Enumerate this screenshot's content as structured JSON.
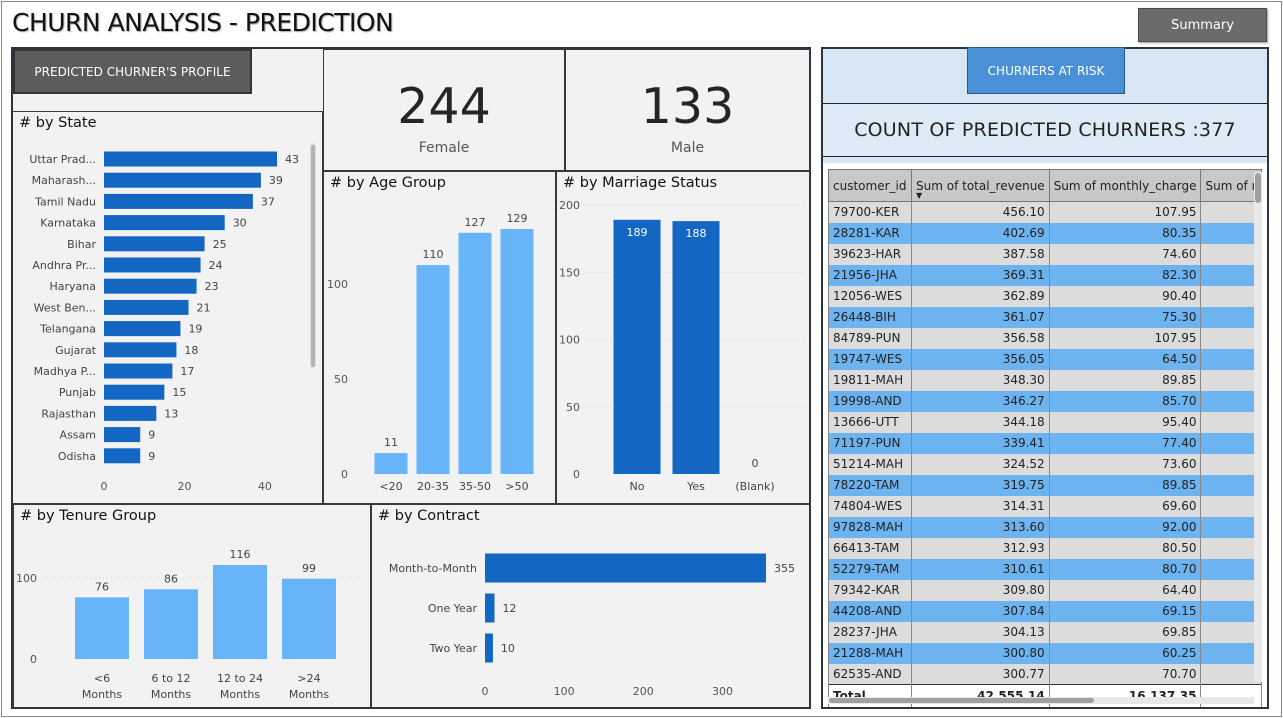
{
  "title": "CHURN ANALYSIS - PREDICTION",
  "summary_button": "Summary",
  "profile_tab": "PREDICTED CHURNER'S PROFILE",
  "risk_tab": "CHURNERS AT RISK",
  "count_label": "COUNT OF PREDICTED CHURNERS :377",
  "kpi": {
    "female": {
      "value": "244",
      "label": "Female"
    },
    "male": {
      "value": "133",
      "label": "Male"
    }
  },
  "colors": {
    "dark_blue": "#1366c2",
    "light_blue": "#67b4f8",
    "row_blue": "#6cb3ef",
    "row_gray": "#dcdcdc"
  },
  "chart_data": [
    {
      "id": "state",
      "type": "bar",
      "orientation": "horizontal",
      "title": "# by State",
      "categories": [
        "Uttar Prad...",
        "Maharash...",
        "Tamil Nadu",
        "Karnataka",
        "Bihar",
        "Andhra Pr...",
        "Haryana",
        "West Ben...",
        "Telangana",
        "Gujarat",
        "Madhya P...",
        "Punjab",
        "Rajasthan",
        "Assam",
        "Odisha"
      ],
      "values": [
        43,
        39,
        37,
        30,
        25,
        24,
        23,
        21,
        19,
        18,
        17,
        15,
        13,
        9,
        9
      ],
      "xlim": [
        0,
        43
      ],
      "xticks": [
        0,
        20,
        40
      ],
      "color": "#1366c2"
    },
    {
      "id": "age",
      "type": "bar",
      "title": "# by Age Group",
      "categories": [
        "<20",
        "20-35",
        "35-50",
        ">50"
      ],
      "values": [
        11,
        110,
        127,
        129
      ],
      "ylim": [
        0,
        129
      ],
      "yticks": [
        0,
        50,
        100
      ],
      "color": "#67b4f8"
    },
    {
      "id": "marriage",
      "type": "bar",
      "title": "# by Marriage Status",
      "categories": [
        "No",
        "Yes",
        "(Blank)"
      ],
      "values": [
        189,
        188,
        0
      ],
      "ylim": [
        0,
        200
      ],
      "yticks": [
        0,
        50,
        100,
        150,
        200
      ],
      "color": "#1366c2"
    },
    {
      "id": "tenure",
      "type": "bar",
      "title": "# by Tenure Group",
      "categories": [
        "<6 Months",
        "6 to 12 Months",
        "12 to 24 Months",
        ">24 Months"
      ],
      "values": [
        76,
        86,
        116,
        99
      ],
      "ylim": [
        0,
        116
      ],
      "yticks": [
        0,
        100
      ],
      "color": "#67b4f8"
    },
    {
      "id": "contract",
      "type": "bar",
      "orientation": "horizontal",
      "title": "# by Contract",
      "categories": [
        "Month-to-Month",
        "One Year",
        "Two Year"
      ],
      "values": [
        355,
        12,
        10
      ],
      "xlim": [
        0,
        355
      ],
      "xticks": [
        0,
        100,
        200,
        300
      ],
      "color": "#1366c2"
    }
  ],
  "table": {
    "columns": [
      "customer_id",
      "Sum of total_revenue",
      "Sum of monthly_charge",
      "Sum of r"
    ],
    "rows": [
      [
        "79700-KER",
        "456.10",
        "107.95"
      ],
      [
        "28281-KAR",
        "402.69",
        "80.35"
      ],
      [
        "39623-HAR",
        "387.58",
        "74.60"
      ],
      [
        "21956-JHA",
        "369.31",
        "82.30"
      ],
      [
        "12056-WES",
        "362.89",
        "90.40"
      ],
      [
        "26448-BIH",
        "361.07",
        "75.30"
      ],
      [
        "84789-PUN",
        "356.58",
        "107.95"
      ],
      [
        "19747-WES",
        "356.05",
        "64.50"
      ],
      [
        "19811-MAH",
        "348.30",
        "89.85"
      ],
      [
        "19998-AND",
        "346.27",
        "85.70"
      ],
      [
        "13666-UTT",
        "344.18",
        "95.40"
      ],
      [
        "71197-PUN",
        "339.41",
        "77.40"
      ],
      [
        "51214-MAH",
        "324.52",
        "73.60"
      ],
      [
        "78220-TAM",
        "319.75",
        "89.85"
      ],
      [
        "74804-WES",
        "314.31",
        "69.60"
      ],
      [
        "97828-MAH",
        "313.60",
        "92.00"
      ],
      [
        "66413-TAM",
        "312.93",
        "80.50"
      ],
      [
        "52279-TAM",
        "310.61",
        "80.70"
      ],
      [
        "79342-KAR",
        "309.80",
        "64.40"
      ],
      [
        "44208-AND",
        "307.84",
        "69.15"
      ],
      [
        "28237-JHA",
        "304.13",
        "69.85"
      ],
      [
        "21288-MAH",
        "300.80",
        "60.25"
      ],
      [
        "62535-AND",
        "300.77",
        "70.70"
      ]
    ],
    "total": [
      "Total",
      "42,555.14",
      "16,137.35"
    ]
  }
}
